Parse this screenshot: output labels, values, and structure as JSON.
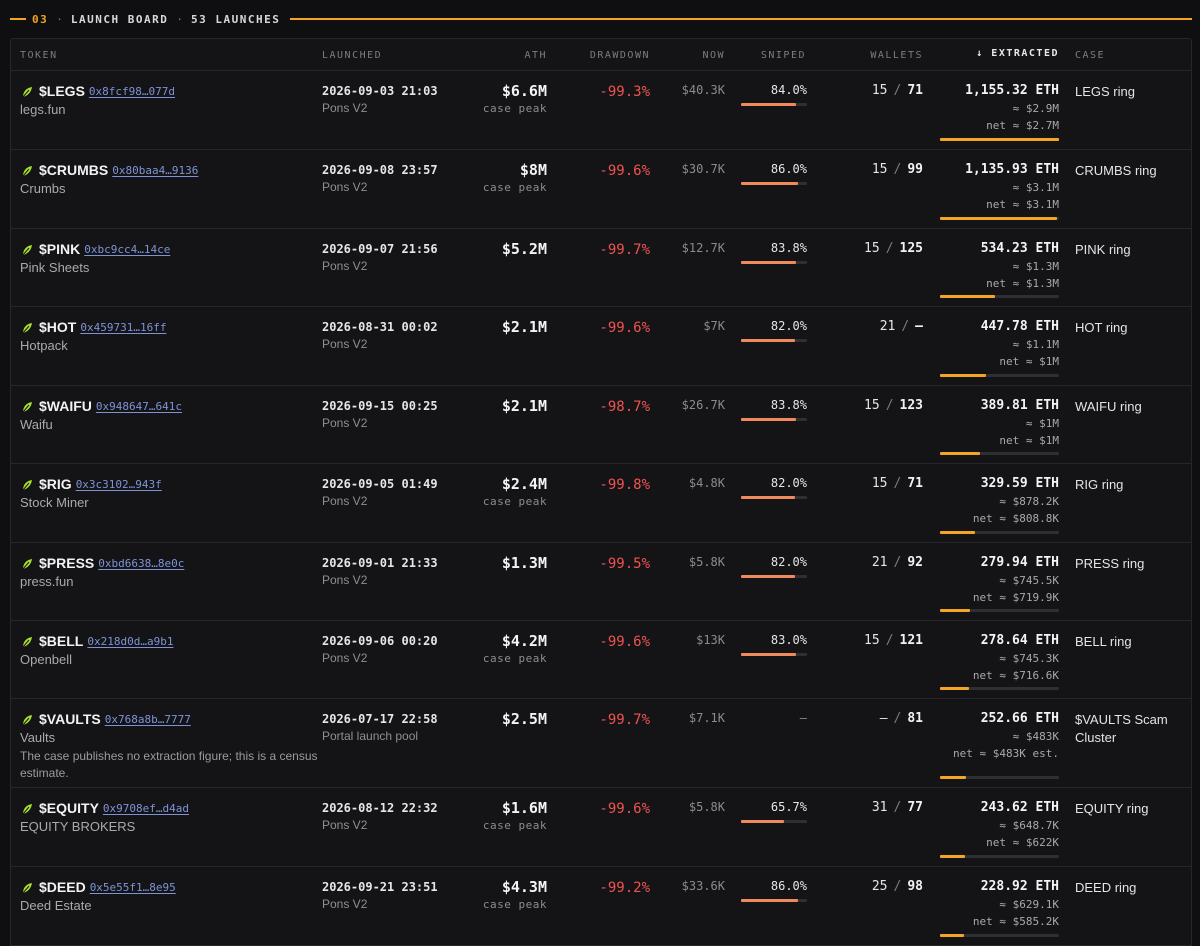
{
  "section": {
    "number": "03",
    "title": "LAUNCH BOARD",
    "count_label": "53 LAUNCHES"
  },
  "columns": {
    "token": "TOKEN",
    "launched": "LAUNCHED",
    "ath": "ATH",
    "drawdown": "DRAWDOWN",
    "now": "NOW",
    "sniped": "SNIPED",
    "wallets": "WALLETS",
    "extracted": "↓ EXTRACTED",
    "case": "CASE"
  },
  "colors": {
    "accent": "#f5a524",
    "drawdown": "#ef5350",
    "snipe_bar": "#f08a5d",
    "address_link": "#7e93d6",
    "leaf": "#a6e22e"
  },
  "icons": {
    "token_leaf": "leaf-icon",
    "sort": "arrow-down-icon"
  },
  "rows": [
    {
      "ticker": "$LEGS",
      "address": "0x8fcf98…077d",
      "name": "legs.fun",
      "note": "",
      "launched": "2026-09-03 21:03",
      "platform": "Pons V2",
      "ath": "$6.6M",
      "ath_sub": "case peak",
      "drawdown": "-99.3%",
      "now": "$40.3K",
      "sniped": "84.0%",
      "sniped_pct": 84.0,
      "wallets_a": "15",
      "wallets_total": "71",
      "extracted_eth": "1,155.32 ETH",
      "extracted_usd": "≈ $2.9M",
      "extracted_net": "net ≈ $2.7M",
      "extracted_frac": 1.0,
      "case": "LEGS ring"
    },
    {
      "ticker": "$CRUMBS",
      "address": "0x80baa4…9136",
      "name": "Crumbs",
      "note": "",
      "launched": "2026-09-08 23:57",
      "platform": "Pons V2",
      "ath": "$8M",
      "ath_sub": "case peak",
      "drawdown": "-99.6%",
      "now": "$30.7K",
      "sniped": "86.0%",
      "sniped_pct": 86.0,
      "wallets_a": "15",
      "wallets_total": "99",
      "extracted_eth": "1,135.93 ETH",
      "extracted_usd": "≈ $3.1M",
      "extracted_net": "net ≈ $3.1M",
      "extracted_frac": 0.98,
      "case": "CRUMBS ring"
    },
    {
      "ticker": "$PINK",
      "address": "0xbc9cc4…14ce",
      "name": "Pink Sheets",
      "note": "",
      "launched": "2026-09-07 21:56",
      "platform": "Pons V2",
      "ath": "$5.2M",
      "ath_sub": "",
      "drawdown": "-99.7%",
      "now": "$12.7K",
      "sniped": "83.8%",
      "sniped_pct": 83.8,
      "wallets_a": "15",
      "wallets_total": "125",
      "extracted_eth": "534.23 ETH",
      "extracted_usd": "≈ $1.3M",
      "extracted_net": "net ≈ $1.3M",
      "extracted_frac": 0.46,
      "case": "PINK ring"
    },
    {
      "ticker": "$HOT",
      "address": "0x459731…16ff",
      "name": "Hotpack",
      "note": "",
      "launched": "2026-08-31 00:02",
      "platform": "Pons V2",
      "ath": "$2.1M",
      "ath_sub": "",
      "drawdown": "-99.6%",
      "now": "$7K",
      "sniped": "82.0%",
      "sniped_pct": 82.0,
      "wallets_a": "21",
      "wallets_total": "—",
      "extracted_eth": "447.78 ETH",
      "extracted_usd": "≈ $1.1M",
      "extracted_net": "net ≈ $1M",
      "extracted_frac": 0.39,
      "case": "HOT ring"
    },
    {
      "ticker": "$WAIFU",
      "address": "0x948647…641c",
      "name": "Waifu",
      "note": "",
      "launched": "2026-09-15 00:25",
      "platform": "Pons V2",
      "ath": "$2.1M",
      "ath_sub": "",
      "drawdown": "-98.7%",
      "now": "$26.7K",
      "sniped": "83.8%",
      "sniped_pct": 83.8,
      "wallets_a": "15",
      "wallets_total": "123",
      "extracted_eth": "389.81 ETH",
      "extracted_usd": "≈ $1M",
      "extracted_net": "net ≈ $1M",
      "extracted_frac": 0.34,
      "case": "WAIFU ring"
    },
    {
      "ticker": "$RIG",
      "address": "0x3c3102…943f",
      "name": "Stock Miner",
      "note": "",
      "launched": "2026-09-05 01:49",
      "platform": "Pons V2",
      "ath": "$2.4M",
      "ath_sub": "case peak",
      "drawdown": "-99.8%",
      "now": "$4.8K",
      "sniped": "82.0%",
      "sniped_pct": 82.0,
      "wallets_a": "15",
      "wallets_total": "71",
      "extracted_eth": "329.59 ETH",
      "extracted_usd": "≈ $878.2K",
      "extracted_net": "net ≈ $808.8K",
      "extracted_frac": 0.29,
      "case": "RIG ring"
    },
    {
      "ticker": "$PRESS",
      "address": "0xbd6638…8e0c",
      "name": "press.fun",
      "note": "",
      "launched": "2026-09-01 21:33",
      "platform": "Pons V2",
      "ath": "$1.3M",
      "ath_sub": "",
      "drawdown": "-99.5%",
      "now": "$5.8K",
      "sniped": "82.0%",
      "sniped_pct": 82.0,
      "wallets_a": "21",
      "wallets_total": "92",
      "extracted_eth": "279.94 ETH",
      "extracted_usd": "≈ $745.5K",
      "extracted_net": "net ≈ $719.9K",
      "extracted_frac": 0.25,
      "case": "PRESS ring"
    },
    {
      "ticker": "$BELL",
      "address": "0x218d0d…a9b1",
      "name": "Openbell",
      "note": "",
      "launched": "2026-09-06 00:20",
      "platform": "Pons V2",
      "ath": "$4.2M",
      "ath_sub": "case peak",
      "drawdown": "-99.6%",
      "now": "$13K",
      "sniped": "83.0%",
      "sniped_pct": 83.0,
      "wallets_a": "15",
      "wallets_total": "121",
      "extracted_eth": "278.64 ETH",
      "extracted_usd": "≈ $745.3K",
      "extracted_net": "net ≈ $716.6K",
      "extracted_frac": 0.24,
      "case": "BELL ring"
    },
    {
      "ticker": "$VAULTS",
      "address": "0x768a8b…7777",
      "name": "Vaults",
      "note": "The case publishes no extraction figure; this is a census estimate.",
      "launched": "2026-07-17 22:58",
      "platform": "Portal launch pool",
      "ath": "$2.5M",
      "ath_sub": "",
      "drawdown": "-99.7%",
      "now": "$7.1K",
      "sniped": "—",
      "sniped_pct": 0,
      "wallets_a": "—",
      "wallets_total": "81",
      "extracted_eth": "252.66 ETH",
      "extracted_usd": "≈ $483K",
      "extracted_net": "net ≈ $483K est.",
      "extracted_frac": 0.22,
      "case": "$VAULTS Scam Cluster"
    },
    {
      "ticker": "$EQUITY",
      "address": "0x9708ef…d4ad",
      "name": "EQUITY BROKERS",
      "note": "",
      "launched": "2026-08-12 22:32",
      "platform": "Pons V2",
      "ath": "$1.6M",
      "ath_sub": "case peak",
      "drawdown": "-99.6%",
      "now": "$5.8K",
      "sniped": "65.7%",
      "sniped_pct": 65.7,
      "wallets_a": "31",
      "wallets_total": "77",
      "extracted_eth": "243.62 ETH",
      "extracted_usd": "≈ $648.7K",
      "extracted_net": "net ≈ $622K",
      "extracted_frac": 0.21,
      "case": "EQUITY ring"
    },
    {
      "ticker": "$DEED",
      "address": "0x5e55f1…8e95",
      "name": "Deed Estate",
      "note": "",
      "launched": "2026-09-21 23:51",
      "platform": "Pons V2",
      "ath": "$4.3M",
      "ath_sub": "case peak",
      "drawdown": "-99.2%",
      "now": "$33.6K",
      "sniped": "86.0%",
      "sniped_pct": 86.0,
      "wallets_a": "25",
      "wallets_total": "98",
      "extracted_eth": "228.92 ETH",
      "extracted_usd": "≈ $629.1K",
      "extracted_net": "net ≈ $585.2K",
      "extracted_frac": 0.2,
      "case": "DEED ring"
    }
  ]
}
